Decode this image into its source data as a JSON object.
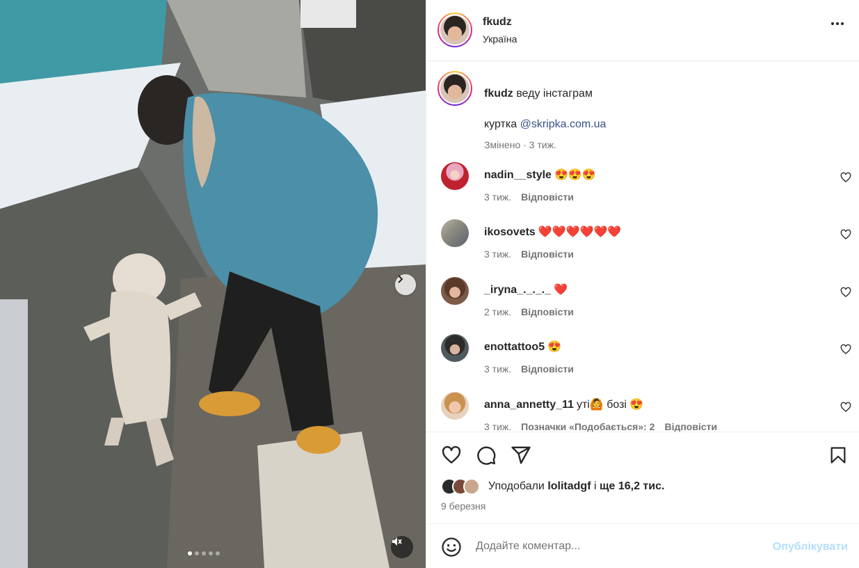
{
  "post": {
    "username": "fkudz",
    "location": "Україна"
  },
  "caption": {
    "username": "fkudz",
    "text": "веду інстаграм",
    "line2_prefix": "куртка ",
    "mention": "@skripka.com.ua",
    "meta": "Змінено · 3 тиж."
  },
  "comments": [
    {
      "username": "nadin__style",
      "text": "😍😍😍",
      "time": "3 тиж.",
      "reply": "Відповісти",
      "likes": ""
    },
    {
      "username": "ikosovets",
      "text": "❤️❤️❤️❤️❤️❤️",
      "time": "3 тиж.",
      "reply": "Відповісти",
      "likes": ""
    },
    {
      "username": "_iryna_._._._",
      "text": "❤️",
      "time": "2 тиж.",
      "reply": "Відповісти",
      "likes": ""
    },
    {
      "username": "enottattoo5",
      "text": "😍",
      "time": "3 тиж.",
      "reply": "Відповісти",
      "likes": ""
    },
    {
      "username": "anna_annetty_11",
      "text": "уті🙆 бозі 😍",
      "time": "3 тиж.",
      "reply": "Відповісти",
      "likes": "Позначки «Подобається»: 2"
    }
  ],
  "likes": {
    "prefix": "Уподобали ",
    "user": "lolitadgf",
    "middle": " і ",
    "count": "ще 16,2 тис."
  },
  "date": "9 березня",
  "add_comment": {
    "placeholder": "Додайте коментар...",
    "publish": "Опублікувати"
  },
  "carousel": {
    "slides": 5,
    "active": 0
  },
  "icons": [
    "more-icon",
    "heart-icon",
    "comment-icon",
    "share-icon",
    "bookmark-icon",
    "emoji-icon",
    "chevron-right-icon",
    "mute-icon"
  ],
  "colors": {
    "link": "#385185",
    "publish_disabled": "#b2dffc",
    "meta": "#737373"
  }
}
